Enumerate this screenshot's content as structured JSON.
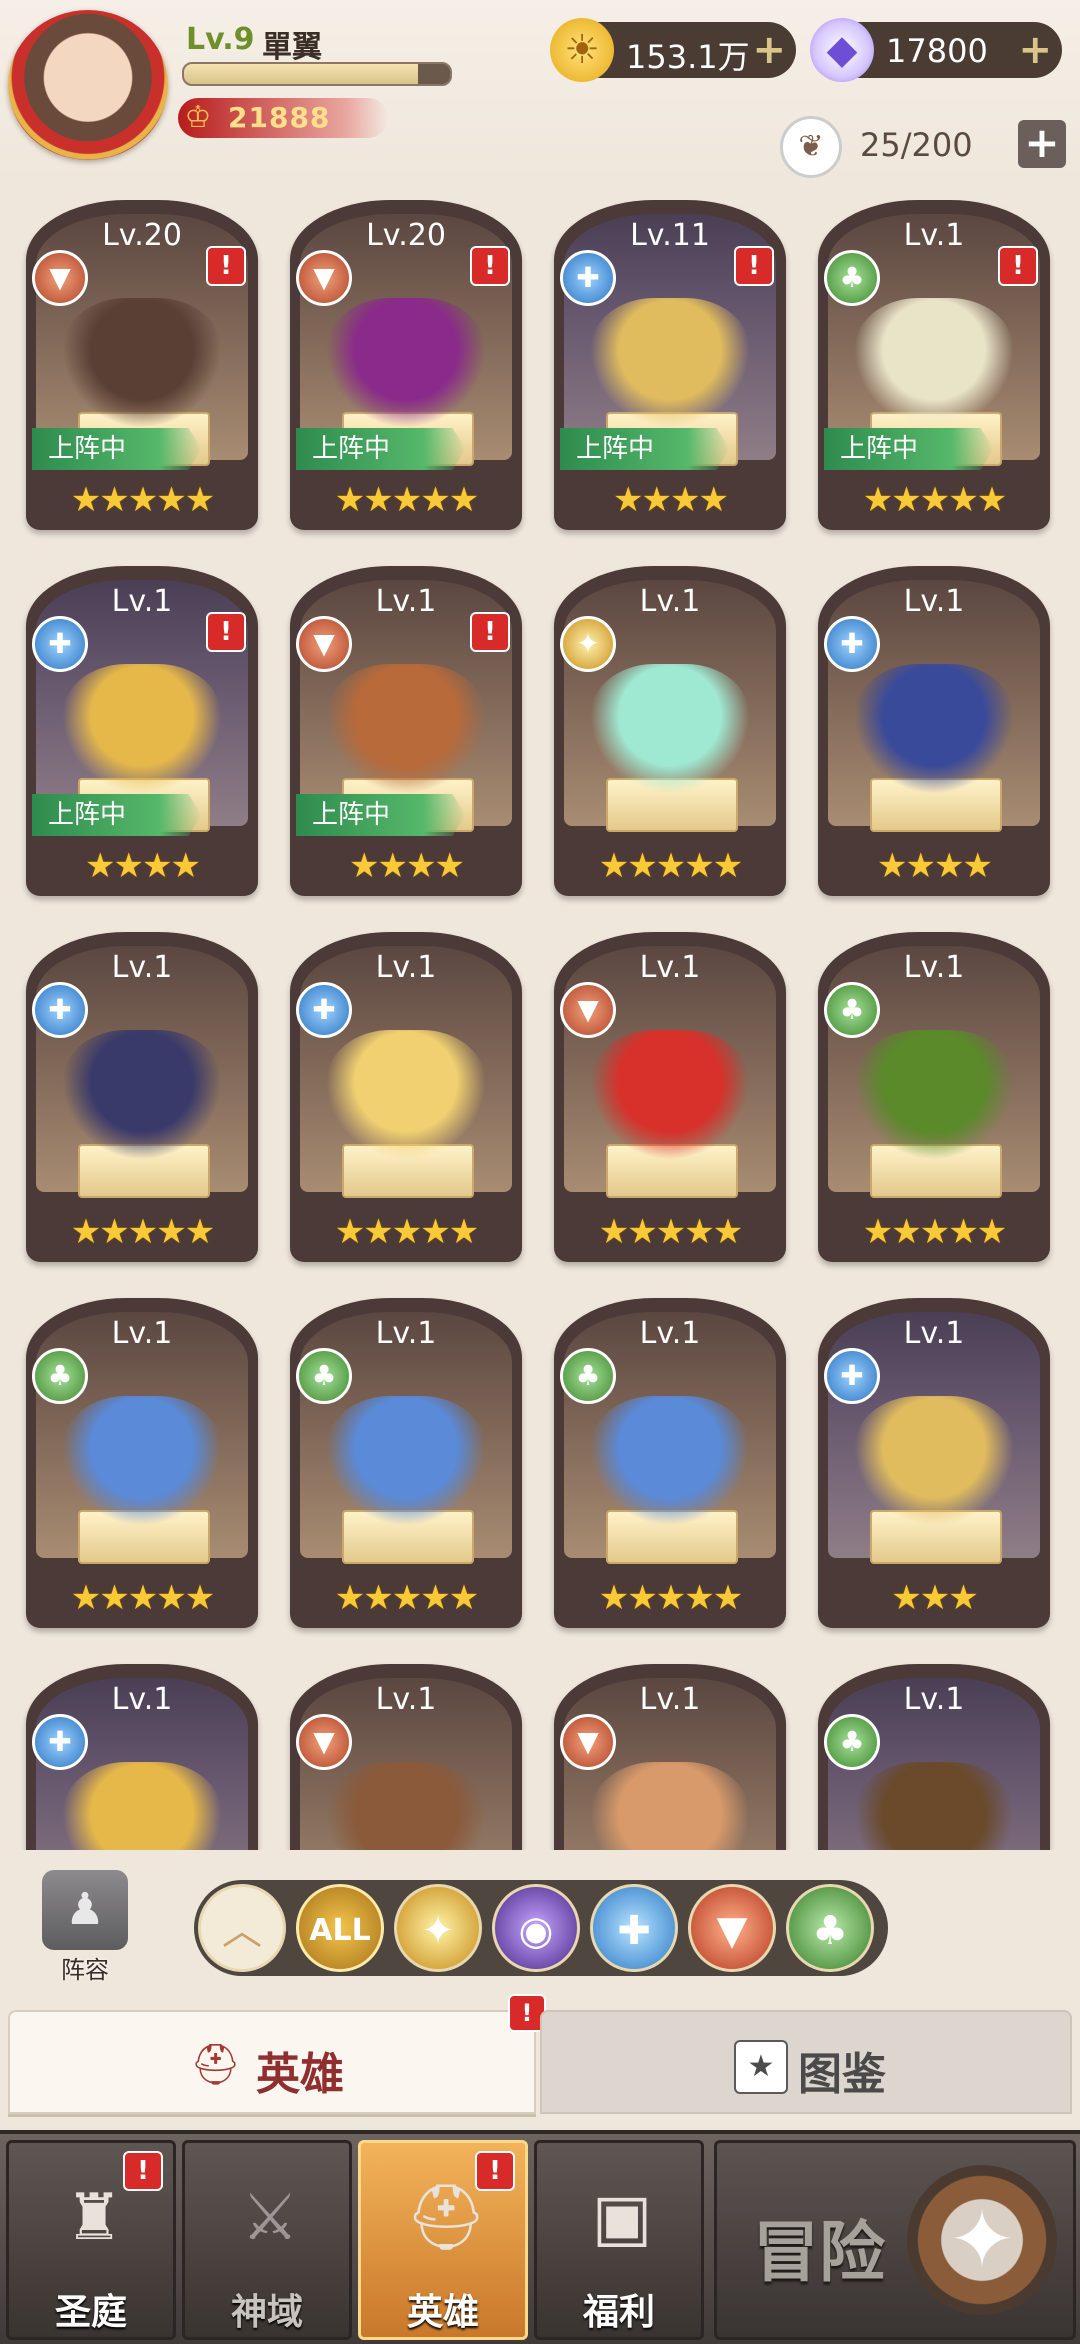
{
  "player": {
    "level": "Lv.9",
    "name": "單翼",
    "exp_fraction": 0.88,
    "power": "21888"
  },
  "currencies": {
    "gold": "153.1万",
    "gems": "17800"
  },
  "capacity": "25/200",
  "heroes": [
    {
      "level": "Lv.20",
      "faction": "fire",
      "stars": "★★★★★",
      "deployed": true,
      "alert": true,
      "bg": "warm",
      "hero_color": "#5a3f34"
    },
    {
      "level": "Lv.20",
      "faction": "fire",
      "stars": "★★★★★",
      "deployed": true,
      "alert": true,
      "bg": "warm",
      "hero_color": "#8a2a8a"
    },
    {
      "level": "Lv.11",
      "faction": "light",
      "stars": "★★★★",
      "deployed": true,
      "alert": true,
      "bg": "violet",
      "hero_color": "#e0bc5e"
    },
    {
      "level": "Lv.1",
      "faction": "nature",
      "stars": "★★★★★",
      "deployed": true,
      "alert": true,
      "bg": "warm",
      "hero_color": "#e8e4c8"
    },
    {
      "level": "Lv.1",
      "faction": "light",
      "stars": "★★★★",
      "deployed": true,
      "alert": true,
      "bg": "violet",
      "hero_color": "#e6b84a"
    },
    {
      "level": "Lv.1",
      "faction": "fire",
      "stars": "★★★★",
      "deployed": true,
      "alert": true,
      "bg": "warm",
      "hero_color": "#b86a3a"
    },
    {
      "level": "Lv.1",
      "faction": "holy",
      "stars": "★★★★★",
      "deployed": false,
      "alert": false,
      "bg": "warm",
      "hero_color": "#9fe8d2"
    },
    {
      "level": "Lv.1",
      "faction": "light",
      "stars": "★★★★",
      "deployed": false,
      "alert": false,
      "bg": "warm",
      "hero_color": "#3a4a9a"
    },
    {
      "level": "Lv.1",
      "faction": "light",
      "stars": "★★★★★",
      "deployed": false,
      "alert": false,
      "bg": "warm",
      "hero_color": "#3a3a6a"
    },
    {
      "level": "Lv.1",
      "faction": "light",
      "stars": "★★★★★",
      "deployed": false,
      "alert": false,
      "bg": "warm",
      "hero_color": "#f0d070"
    },
    {
      "level": "Lv.1",
      "faction": "fire",
      "stars": "★★★★★",
      "deployed": false,
      "alert": false,
      "bg": "warm",
      "hero_color": "#d8302a"
    },
    {
      "level": "Lv.1",
      "faction": "nature",
      "stars": "★★★★★",
      "deployed": false,
      "alert": false,
      "bg": "warm",
      "hero_color": "#5a8a2a"
    },
    {
      "level": "Lv.1",
      "faction": "nature",
      "stars": "★★★★★",
      "deployed": false,
      "alert": false,
      "bg": "warm",
      "hero_color": "#5a8ad8"
    },
    {
      "level": "Lv.1",
      "faction": "nature",
      "stars": "★★★★★",
      "deployed": false,
      "alert": false,
      "bg": "warm",
      "hero_color": "#5a8ad8"
    },
    {
      "level": "Lv.1",
      "faction": "nature",
      "stars": "★★★★★",
      "deployed": false,
      "alert": false,
      "bg": "warm",
      "hero_color": "#5a8ad8"
    },
    {
      "level": "Lv.1",
      "faction": "light",
      "stars": "★★★",
      "deployed": false,
      "alert": false,
      "bg": "violet",
      "hero_color": "#e0bc5e"
    },
    {
      "level": "Lv.1",
      "faction": "light",
      "stars": "",
      "deployed": false,
      "alert": false,
      "bg": "violet",
      "hero_color": "#e6b84a"
    },
    {
      "level": "Lv.1",
      "faction": "fire",
      "stars": "",
      "deployed": false,
      "alert": false,
      "bg": "warm",
      "hero_color": "#8a5a3a"
    },
    {
      "level": "Lv.1",
      "faction": "fire",
      "stars": "",
      "deployed": false,
      "alert": false,
      "bg": "warm",
      "hero_color": "#d89a6a"
    },
    {
      "level": "Lv.1",
      "faction": "nature",
      "stars": "",
      "deployed": false,
      "alert": false,
      "bg": "violet",
      "hero_color": "#6a4a2a"
    }
  ],
  "deploy_label": "上阵中",
  "faction_icons": {
    "fire": "wolf-icon",
    "light": "shield-cross-icon",
    "nature": "tree-icon",
    "holy": "sun-wing-icon"
  },
  "filters": {
    "team_label": "阵容",
    "all_label": "ALL",
    "items": [
      "collapse",
      "all",
      "holy",
      "dark",
      "light",
      "fire",
      "nature"
    ]
  },
  "tabs": {
    "heroes": "英雄",
    "codex": "图鉴"
  },
  "nav": {
    "sanctuary": "圣庭",
    "divine": "神域",
    "heroes": "英雄",
    "welfare": "福利",
    "adventure": "冒险"
  },
  "colors": {
    "alert": "#d92a2a",
    "deploy": "#2e8b4e",
    "star": "#f9c937",
    "nav_active": "#e09540"
  }
}
